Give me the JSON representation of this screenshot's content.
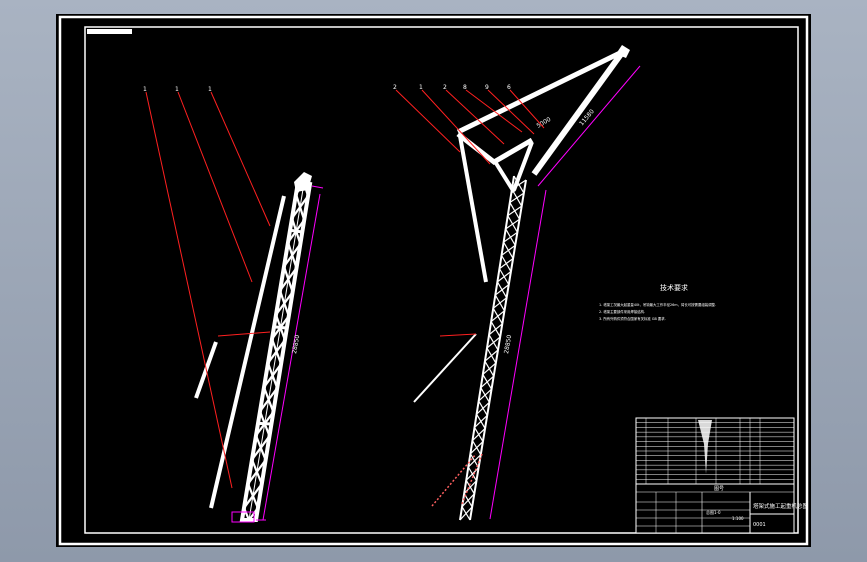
{
  "window": {
    "background_color": "#9aa5b5",
    "sheet_color": "#000000"
  },
  "colors": {
    "structure": "#ffffff",
    "leader": "#ff2020",
    "dimension": "#ff00ff",
    "annotation": "#00ff40"
  },
  "drawing": {
    "left_view": {
      "balloons": [
        "1",
        "1",
        "1"
      ],
      "dimension_label": "28850"
    },
    "right_view": {
      "balloons": [
        "2",
        "1",
        "2",
        "8",
        "9",
        "6"
      ],
      "boom_dimension_label": "11580",
      "mast_dimension_label": "28850",
      "tip_label": "5000"
    },
    "technical_notes": {
      "heading": "技术要求",
      "lines": [
        "1. 塔架工况最大起重量40t，吊钩最大工作半径26m，臂长可按需要组装调整.",
        "2. 塔架主要部件采用焊接结构.",
        "3. 所有外购件须符合国家有关标准 GB 要求."
      ]
    },
    "title_block": {
      "title": "塔架式施工起重机总图",
      "drawing_no": "总图1-0",
      "sheet_label": "图号",
      "scale": "1:100",
      "parts_rows": 14,
      "sheet_num": "0001"
    }
  }
}
